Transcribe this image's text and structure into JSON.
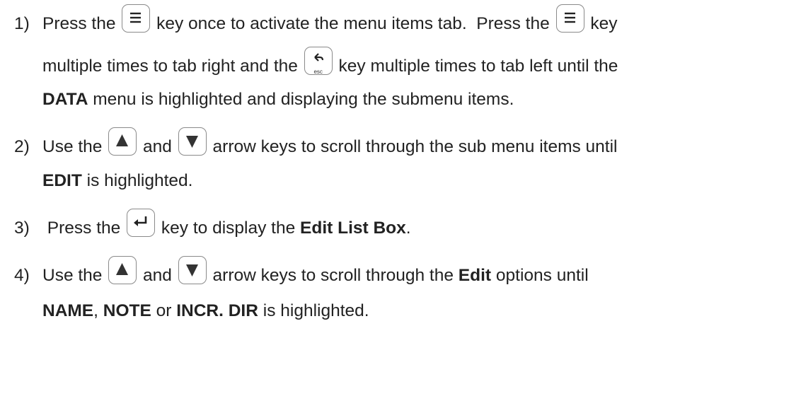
{
  "steps": [
    {
      "number": "1)",
      "lines": [
        {
          "a": "Press the ",
          "b": " key once to activate the menu items tab.  Press the ",
          "c": " key"
        },
        {
          "a": "multiple times to tab right and the ",
          "b": " key multiple times to tab left until the"
        },
        {
          "bold": "DATA",
          "rest": " menu is highlighted and displaying the submenu items."
        }
      ]
    },
    {
      "number": "2)",
      "lines": [
        {
          "a": "Use the ",
          "b": " and ",
          "c": " arrow keys to scroll through the sub menu items until"
        },
        {
          "bold": "EDIT",
          "rest": " is highlighted."
        }
      ]
    },
    {
      "number": "3)",
      "lines": [
        {
          "a": " Press the ",
          "b": " key to display the ",
          "bold": "Edit List Box",
          "end": "."
        }
      ]
    },
    {
      "number": "4)",
      "lines": [
        {
          "a": "Use the ",
          "b": " and ",
          "c": " arrow keys to scroll through the ",
          "bold": "Edit",
          "d": " options until"
        },
        {
          "bold1": "NAME",
          "s1": ", ",
          "bold2": "NOTE",
          "s2": " or ",
          "bold3": "INCR. DIR",
          "rest": " is highlighted."
        }
      ]
    }
  ],
  "keys": {
    "menu": "menu-icon",
    "esc": "esc",
    "up": "up-arrow-icon",
    "down": "down-arrow-icon",
    "enter": "enter-icon"
  }
}
